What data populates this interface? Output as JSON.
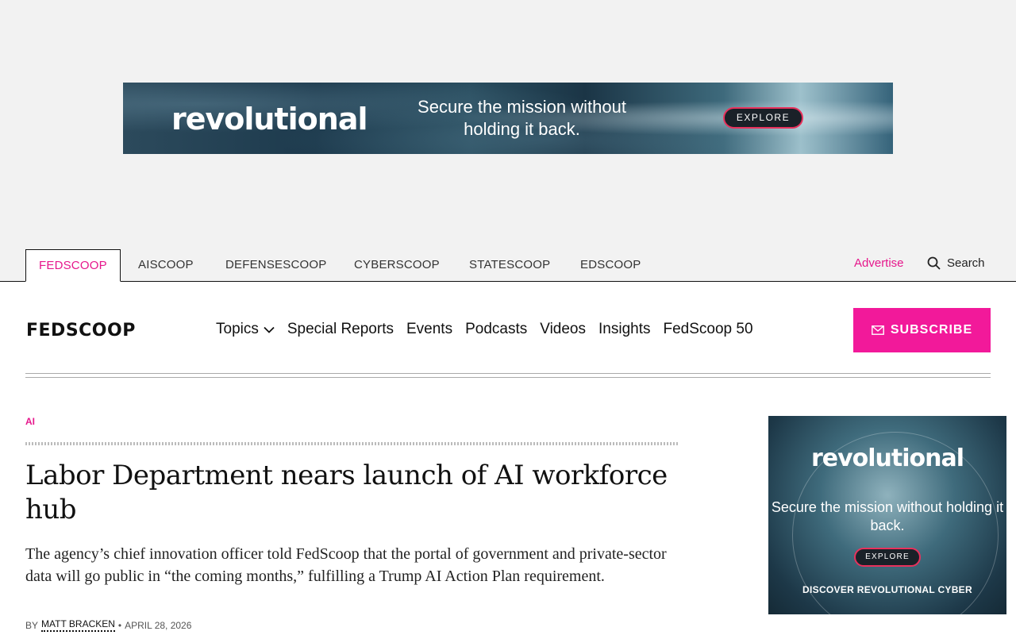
{
  "top_ad": {
    "brand": "revolutional",
    "tagline": "Secure the mission without holding it back.",
    "button": "EXPLORE"
  },
  "network": {
    "tabs": [
      "FEDSCOOP",
      "AISCOOP",
      "DEFENSESCOOP",
      "CYBERSCOOP",
      "STATESCOOP",
      "EDSCOOP"
    ],
    "active_tab": "FEDSCOOP",
    "advertise": "Advertise",
    "search": "Search"
  },
  "header": {
    "logo": "FEDSCOOP",
    "nav": [
      "Topics",
      "Special Reports",
      "Events",
      "Podcasts",
      "Videos",
      "Insights",
      "FedScoop 50"
    ],
    "subscribe": "SUBSCRIBE"
  },
  "article": {
    "category": "AI",
    "headline": "Labor Department nears launch of AI workforce hub",
    "dek": "The agency’s chief innovation officer told FedScoop that the portal of government and private-sector data will go public in “the coming months,” fulfilling a Trump AI Action Plan requirement.",
    "by": "BY",
    "author": "MATT BRACKEN",
    "separator": "•",
    "date": "APRIL 28, 2026"
  },
  "side_ad": {
    "brand": "revolutional",
    "tagline": "Secure the mission without holding it back.",
    "button": "EXPLORE",
    "footer": "DISCOVER REVOLUTIONAL CYBER"
  },
  "colors": {
    "accent": "#e6178c",
    "subscribe_bg": "#f2199a",
    "ad_bg": "#f2f2f2"
  }
}
